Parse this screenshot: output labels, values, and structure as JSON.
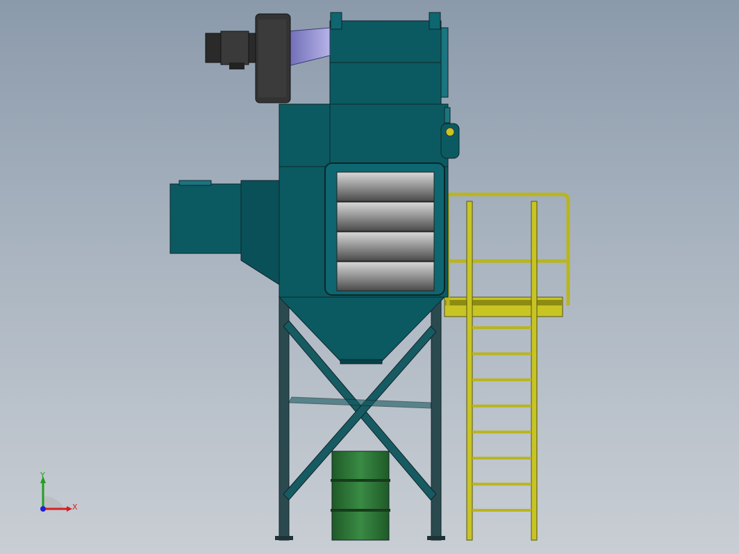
{
  "viewport": {
    "background_top": "#8b9aab",
    "background_bottom": "#c9ced4"
  },
  "model": {
    "components": [
      "fan-motor",
      "blower-housing",
      "transition-duct",
      "upper-clean-air-plenum",
      "filter-housing",
      "inlet-duct",
      "filter-access-door",
      "hopper",
      "support-legs",
      "cross-bracing",
      "collection-drum",
      "access-platform",
      "guard-rail",
      "access-ladder",
      "side-valve"
    ],
    "colors": {
      "housing": "#0b5a62",
      "housing_dark": "#064148",
      "outline": "#0e2528",
      "motor": "#2a2a2a",
      "duct": "#8a86c9",
      "door_panel": "#9a9a9a",
      "platform": "#c8c424",
      "drum": "#2f7a3a",
      "legs": "#2b4a4f"
    },
    "ladder_rungs": 8
  },
  "triad": {
    "x_label": "X",
    "y_label": "Y",
    "x_color": "#d42020",
    "y_color": "#20a020",
    "z_color": "#2020d4"
  }
}
